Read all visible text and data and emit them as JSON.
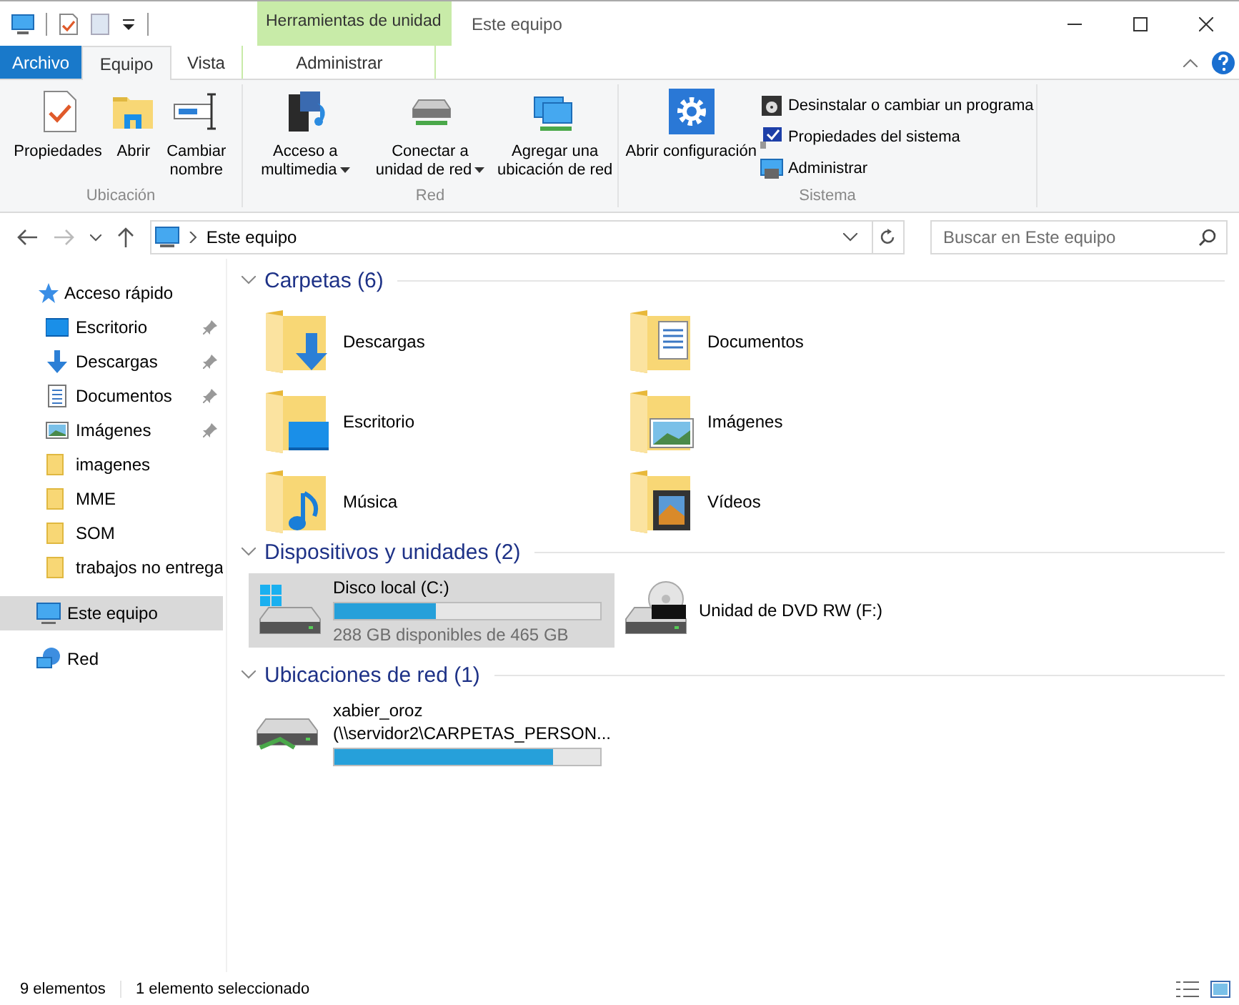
{
  "window": {
    "title": "Este equipo",
    "context_tab_group": "Herramientas de unidad"
  },
  "tabs": [
    {
      "label": "Archivo",
      "kind": "file",
      "selected": false
    },
    {
      "label": "Equipo",
      "kind": "tab",
      "selected": true
    },
    {
      "label": "Vista",
      "kind": "tab",
      "selected": false
    },
    {
      "label": "Administrar",
      "kind": "context",
      "selected": false
    }
  ],
  "ribbon": {
    "groups": [
      {
        "label": "Ubicación",
        "buttons": [
          {
            "label": "Propiedades",
            "kind": "properties",
            "dropdown": false
          },
          {
            "label": "Abrir",
            "kind": "open",
            "dropdown": false
          },
          {
            "label": "Cambiar nombre",
            "kind": "rename",
            "dropdown": false
          }
        ]
      },
      {
        "label": "Red",
        "buttons": [
          {
            "label": "Acceso a multimedia",
            "kind": "media",
            "dropdown": true
          },
          {
            "label": "Conectar a unidad de red",
            "kind": "netdrive",
            "dropdown": true
          },
          {
            "label": "Agregar una ubicación de red",
            "kind": "netloc",
            "dropdown": false
          }
        ]
      },
      {
        "label": "Sistema",
        "buttons": [
          {
            "label": "Abrir configuración",
            "kind": "settings",
            "dropdown": false
          }
        ],
        "small_buttons": [
          {
            "label": "Desinstalar o cambiar un programa",
            "kind": "uninstall"
          },
          {
            "label": "Propiedades del sistema",
            "kind": "sysprops"
          },
          {
            "label": "Administrar",
            "kind": "manage"
          }
        ]
      }
    ]
  },
  "address_bar": {
    "path": "Este equipo",
    "search_placeholder": "Buscar en Este equipo"
  },
  "sidebar": {
    "items": [
      {
        "label": "Acceso rápido",
        "kind": "quick",
        "selected": false,
        "children": [
          {
            "label": "Escritorio",
            "kind": "desktop",
            "pinned": true,
            "selected": false
          },
          {
            "label": "Descargas",
            "kind": "downloads",
            "pinned": true,
            "selected": false
          },
          {
            "label": "Documentos",
            "kind": "documents",
            "pinned": true,
            "selected": false
          },
          {
            "label": "Imágenes",
            "kind": "pictures",
            "pinned": true,
            "selected": false
          },
          {
            "label": "imagenes",
            "kind": "folder",
            "pinned": false,
            "selected": false
          },
          {
            "label": "MME",
            "kind": "folder",
            "pinned": false,
            "selected": false
          },
          {
            "label": "SOM",
            "kind": "folder",
            "pinned": false,
            "selected": false
          },
          {
            "label": "trabajos no entrega",
            "kind": "folder",
            "pinned": false,
            "selected": false
          }
        ]
      },
      {
        "label": "Este equipo",
        "kind": "pc",
        "selected": true
      },
      {
        "label": "Red",
        "kind": "network",
        "selected": false
      }
    ]
  },
  "sections": [
    {
      "title": "Carpetas (6)",
      "kind": "folders",
      "items": [
        {
          "name": "Descargas",
          "kind": "downloads"
        },
        {
          "name": "Documentos",
          "kind": "documents"
        },
        {
          "name": "Escritorio",
          "kind": "desktop"
        },
        {
          "name": "Imágenes",
          "kind": "pictures"
        },
        {
          "name": "Música",
          "kind": "music"
        },
        {
          "name": "Vídeos",
          "kind": "videos"
        }
      ]
    },
    {
      "title": "Dispositivos y unidades (2)",
      "kind": "drives",
      "items": [
        {
          "name": "Disco local (C:)",
          "kind": "disk",
          "level": 0.38,
          "detail": "288 GB disponibles de 465 GB",
          "selected": true
        },
        {
          "name": "Unidad de DVD RW (F:)",
          "kind": "dvd",
          "selected": false
        }
      ]
    },
    {
      "title": "Ubicaciones de red (1)",
      "kind": "drives",
      "items": [
        {
          "name": "xabier_oroz",
          "path": "(\\\\servidor2\\CARPETAS_PERSON...",
          "kind": "netdisk",
          "level": 0.82,
          "selected": false
        }
      ]
    }
  ],
  "status_bar": {
    "count": "9 elementos",
    "selection": "1 elemento seleccionado"
  }
}
